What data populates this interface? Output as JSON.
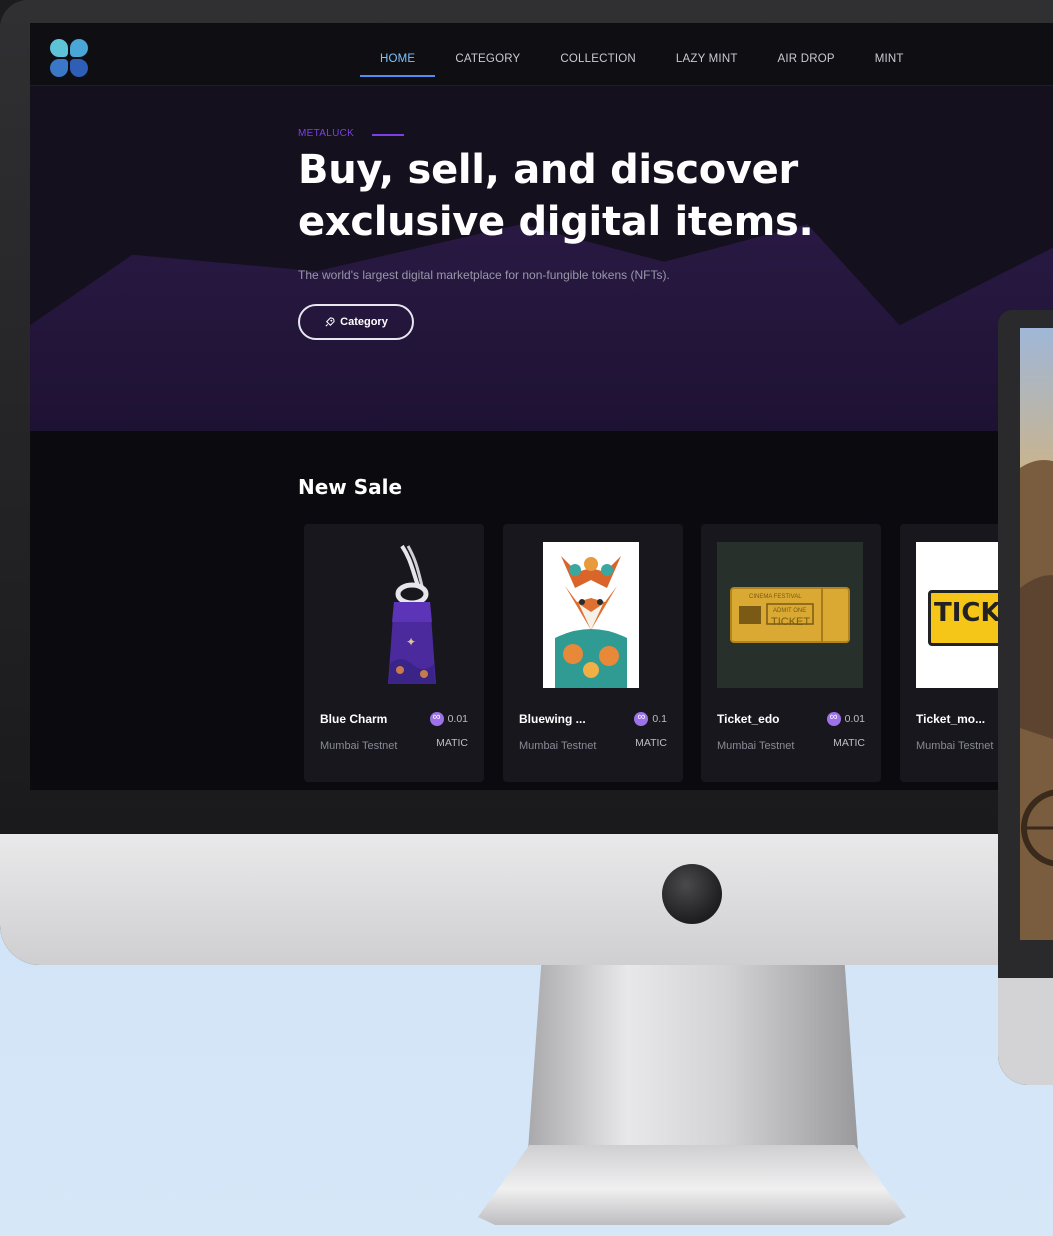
{
  "nav": {
    "items": [
      {
        "label": "HOME",
        "active": true
      },
      {
        "label": "CATEGORY",
        "active": false
      },
      {
        "label": "COLLECTION",
        "active": false
      },
      {
        "label": "LAZY MINT",
        "active": false
      },
      {
        "label": "AIR DROP",
        "active": false
      },
      {
        "label": "MINT",
        "active": false
      }
    ]
  },
  "hero": {
    "eyebrow": "METALUCK",
    "title": "Buy, sell, and discover exclusive digital items.",
    "subtitle": "The world's largest digital marketplace for non-fungible tokens (NFTs).",
    "cta_label": "Category",
    "cta_icon": "rocket-icon"
  },
  "new_sale": {
    "title": "New Sale",
    "cards": [
      {
        "name": "Blue Charm",
        "network": "Mumbai Testnet",
        "price": "0.01",
        "currency": "MATIC"
      },
      {
        "name": "Bluewing ...",
        "network": "Mumbai Testnet",
        "price": "0.1",
        "currency": "MATIC"
      },
      {
        "name": "Ticket_edo",
        "network": "Mumbai Testnet",
        "price": "0.01",
        "currency": "MATIC"
      },
      {
        "name": "Ticket_mo...",
        "network": "Mumbai Testnet",
        "price": "",
        "currency": ""
      }
    ],
    "card_images": {
      "ticket_banner": "CINEMA FESTIVAL",
      "ticket_line1": "ADMIT ONE",
      "ticket_line2": "TICKET",
      "ticket_yellow": "TICK"
    }
  },
  "colors": {
    "accent": "#7b3fe4",
    "active_nav": "#7fc2ff",
    "background": "#0b0b0f",
    "matic": "#9d72e8"
  }
}
